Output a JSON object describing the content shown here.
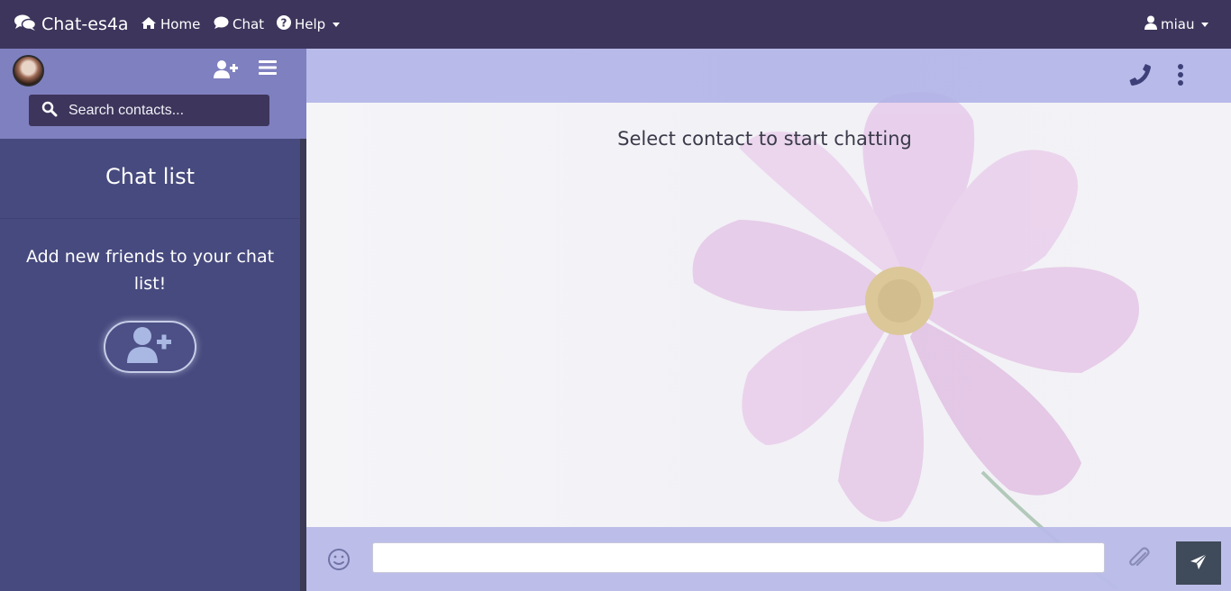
{
  "navbar": {
    "brand": "Chat-es4a",
    "home_label": "Home",
    "chat_label": "Chat",
    "help_label": "Help",
    "user_label": "miau"
  },
  "sidebar": {
    "search_placeholder": "Search contacts...",
    "chat_list_title": "Chat list",
    "empty_message": "Add new friends to your chat list!"
  },
  "main": {
    "prompt": "Select contact to start chatting",
    "message_value": ""
  },
  "colors": {
    "navbar": "#3d355b",
    "sidebar": "#474a7e",
    "sidebar_header": "#7f80c0",
    "chat_header": "#adb0e6",
    "send_button": "#3f4a5a"
  },
  "icons": {
    "brand": "comments-icon",
    "home": "home-icon",
    "chat": "comment-icon",
    "help": "question-circle-icon",
    "user": "user-icon",
    "add_user": "user-plus-icon",
    "menu": "bars-icon",
    "search": "search-icon",
    "phone": "phone-icon",
    "more": "ellipsis-vertical-icon",
    "emoji": "smile-icon",
    "attach": "paperclip-icon",
    "send": "paper-plane-icon"
  }
}
